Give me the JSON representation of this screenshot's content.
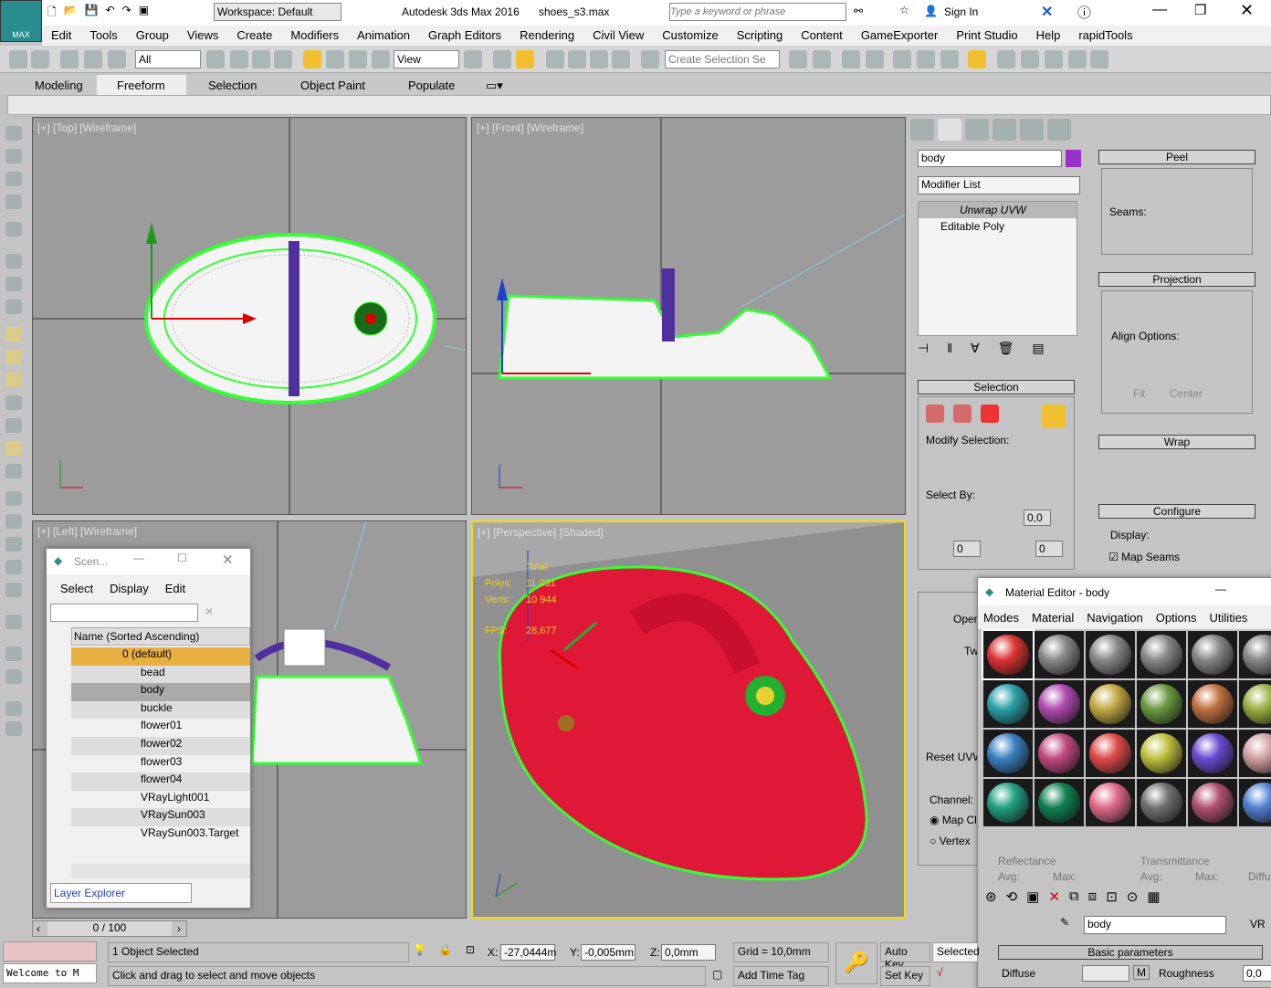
{
  "app": {
    "title": "Autodesk 3ds Max 2016",
    "file": "shoes_s3.max",
    "logo": "MAX",
    "workspace": "Workspace: Default",
    "search_placeholder": "Type a keyword or phrase",
    "sign_in": "Sign In"
  },
  "menu": [
    "Edit",
    "Tools",
    "Group",
    "Views",
    "Create",
    "Modifiers",
    "Animation",
    "Graph Editors",
    "Rendering",
    "Civil View",
    "Customize",
    "Scripting",
    "Content",
    "GameExporter",
    "Print Studio",
    "Help",
    "rapidTools"
  ],
  "toolbar": {
    "selection_filter": "All",
    "ref_coord": "View",
    "named_selection": "Create Selection Se"
  },
  "ribbon": {
    "tabs": [
      "Modeling",
      "Freeform",
      "Selection",
      "Object Paint",
      "Populate"
    ],
    "active": "Freeform"
  },
  "viewports": {
    "top": "[+] [Top] [Wireframe]",
    "front": "[+] [Front] [Wireframe]",
    "left": "[+] [Left] [Wireframe]",
    "perspective": "[+] [Perspective] [Shaded]",
    "stats": {
      "total": "Total",
      "polys_label": "Polys:",
      "polys": "11 031",
      "verts_label": "Verts:",
      "verts": "10 944",
      "fps_label": "FPS:",
      "fps": "28,677"
    }
  },
  "command_panel": {
    "object_name": "body",
    "object_color": "#9b30c8",
    "modifier_list": "Modifier List",
    "stack": [
      "Unwrap UVW",
      "Editable Poly"
    ],
    "selection": {
      "title": "Selection",
      "modify_selection": "Modify Selection:",
      "select_by": "Select By:",
      "val1": "0,0",
      "val2": "0",
      "val3": "0"
    },
    "peel": {
      "title": "Peel",
      "seams": "Seams:"
    },
    "projection": {
      "title": "Projection",
      "align": "Align Options:",
      "fit": "Fit",
      "center": "Center"
    },
    "wrap": {
      "title": "Wrap"
    },
    "configure": {
      "title": "Configure",
      "display": "Display:",
      "map_seams": "Map Seams"
    },
    "partial": {
      "open": "Oper",
      "tw": "Tw",
      "reset": "Reset UVW",
      "channel": "Channel:",
      "map": "Map Cl",
      "vertex": "Vertex"
    }
  },
  "scene_explorer": {
    "title": "Scen...",
    "menu": [
      "Select",
      "Display",
      "Edit"
    ],
    "column": "Name (Sorted Ascending)",
    "layer": "0 (default)",
    "items": [
      "bead",
      "body",
      "buckle",
      "flower01",
      "flower02",
      "flower03",
      "flower04",
      "VRayLight001",
      "VRaySun003",
      "VRaySun003.Target"
    ],
    "selected": "body",
    "footer": "Layer Explorer"
  },
  "material_editor": {
    "title": "Material Editor - body",
    "menu": [
      "Modes",
      "Material",
      "Navigation",
      "Options",
      "Utilities"
    ],
    "spheres": [
      "#d33",
      "#888",
      "#888",
      "#888",
      "#888",
      "#888",
      "#2aa0a8",
      "#b04ab0",
      "#c0a840",
      "#6a9a40",
      "#c07040",
      "#9ab040",
      "#3a80c0",
      "#c04a80",
      "#e04a4a",
      "#c0c040",
      "#6a4ad0",
      "#d0a0a0",
      "#20a080",
      "#108050",
      "#e06a8a",
      "#707070",
      "#b05070",
      "#5080d0"
    ],
    "reflectance": "Reflectance",
    "transmittance": "Transmittance",
    "avg": "Avg:",
    "max": "Max:",
    "diffuse_short": "Diffu",
    "mat_name": "body",
    "basic_params": "Basic parameters",
    "diffuse": "Diffuse",
    "m": "M",
    "roughness": "Roughness",
    "rough_val": "0,0",
    "vr": "VR"
  },
  "timeline": {
    "frame": "0 / 100"
  },
  "status": {
    "selected": "1 Object Selected",
    "prompt": "Click and drag to select and move objects",
    "welcome": "Welcome to M",
    "x_label": "X:",
    "x": "-27,0444m",
    "y_label": "Y:",
    "y": "-0,005mm",
    "z_label": "Z:",
    "z": "0,0mm",
    "grid": "Grid = 10,0mm",
    "add_time_tag": "Add Time Tag",
    "auto_key": "Auto Key",
    "set_key": "Set Key",
    "key_mode": "Selected"
  },
  "colors": {
    "wire": "#33ff33",
    "viewport_bg": "#9c9c9c",
    "active_border": "#f0e000",
    "shoe": "#e01838"
  }
}
